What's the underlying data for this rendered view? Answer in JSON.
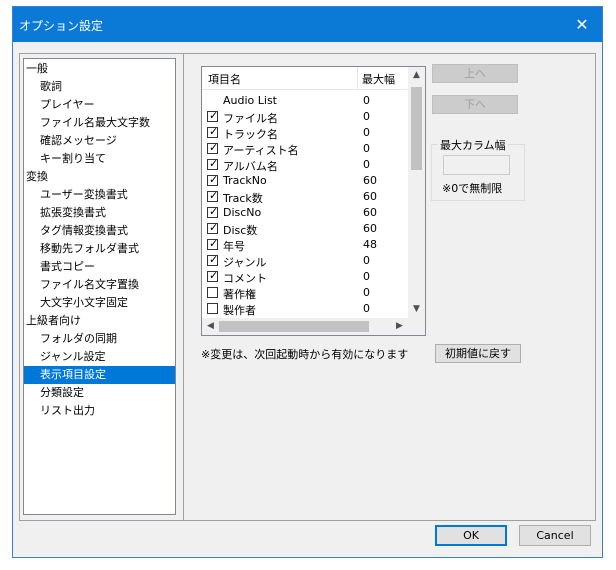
{
  "window": {
    "title": "オプション設定",
    "close_glyph": "✕"
  },
  "tree": [
    {
      "label": "一般",
      "level": 0
    },
    {
      "label": "歌詞",
      "level": 1
    },
    {
      "label": "プレイヤー",
      "level": 1
    },
    {
      "label": "ファイル名最大文字数",
      "level": 1
    },
    {
      "label": "確認メッセージ",
      "level": 1
    },
    {
      "label": "キー割り当て",
      "level": 1
    },
    {
      "label": "変換",
      "level": 0
    },
    {
      "label": "ユーザー変換書式",
      "level": 1
    },
    {
      "label": "拡張変換書式",
      "level": 1
    },
    {
      "label": "タグ情報変換書式",
      "level": 1
    },
    {
      "label": "移動先フォルダ書式",
      "level": 1
    },
    {
      "label": "書式コピー",
      "level": 1
    },
    {
      "label": "ファイル名文字置換",
      "level": 1
    },
    {
      "label": "大文字小文字固定",
      "level": 1
    },
    {
      "label": "上級者向け",
      "level": 0
    },
    {
      "label": "フォルダの同期",
      "level": 1
    },
    {
      "label": "ジャンル設定",
      "level": 1
    },
    {
      "label": "表示項目設定",
      "level": 1,
      "selected": true
    },
    {
      "label": "分類設定",
      "level": 1
    },
    {
      "label": "リスト出力",
      "level": 1
    }
  ],
  "list": {
    "headers": {
      "name": "項目名",
      "width": "最大幅"
    },
    "rows": [
      {
        "name": "Audio List",
        "width": "0",
        "checkbox": false
      },
      {
        "name": "ファイル名",
        "width": "0",
        "checkbox": true,
        "checked": true
      },
      {
        "name": "トラック名",
        "width": "0",
        "checkbox": true,
        "checked": true
      },
      {
        "name": "アーティスト名",
        "width": "0",
        "checkbox": true,
        "checked": true
      },
      {
        "name": "アルバム名",
        "width": "0",
        "checkbox": true,
        "checked": true
      },
      {
        "name": "TrackNo",
        "width": "60",
        "checkbox": true,
        "checked": true
      },
      {
        "name": "Track数",
        "width": "60",
        "checkbox": true,
        "checked": true
      },
      {
        "name": "DiscNo",
        "width": "60",
        "checkbox": true,
        "checked": true
      },
      {
        "name": "Disc数",
        "width": "60",
        "checkbox": true,
        "checked": true
      },
      {
        "name": "年号",
        "width": "48",
        "checkbox": true,
        "checked": true
      },
      {
        "name": "ジャンル",
        "width": "0",
        "checkbox": true,
        "checked": true
      },
      {
        "name": "コメント",
        "width": "0",
        "checkbox": true,
        "checked": true
      },
      {
        "name": "著作権",
        "width": "0",
        "checkbox": true,
        "checked": false
      },
      {
        "name": "製作者",
        "width": "0",
        "checkbox": true,
        "checked": false
      }
    ]
  },
  "buttons": {
    "up": "上へ",
    "down": "下へ",
    "reset": "初期値に戻す",
    "ok": "OK",
    "cancel": "Cancel"
  },
  "max_column_width": {
    "title": "最大カラム幅",
    "value": "",
    "hint": "※0で無制限"
  },
  "note": "※変更は、次回起動時から有効になります",
  "icons": {
    "check": "✓",
    "scroll_up": "▲",
    "scroll_down": "▼",
    "scroll_left": "◀",
    "scroll_right": "▶"
  }
}
